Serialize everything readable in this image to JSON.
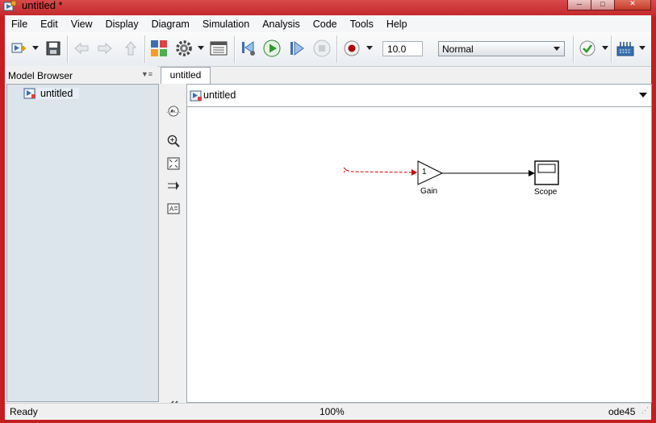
{
  "window": {
    "title": "untitled *"
  },
  "menubar": {
    "items": [
      "File",
      "Edit",
      "View",
      "Display",
      "Diagram",
      "Simulation",
      "Analysis",
      "Code",
      "Tools",
      "Help"
    ]
  },
  "toolbar": {
    "stop_time": "10.0",
    "sim_mode": "Normal",
    "icons": [
      "new-model-icon",
      "save-icon",
      "back-icon",
      "forward-icon",
      "up-icon",
      "library-browser-icon",
      "model-config-icon",
      "model-explorer-icon",
      "step-back-icon",
      "run-icon",
      "step-forward-icon",
      "stop-icon",
      "record-icon",
      "check-icon",
      "build-icon"
    ]
  },
  "model_browser": {
    "title": "Model Browser",
    "items": [
      {
        "label": "untitled"
      }
    ]
  },
  "tabs": [
    {
      "label": "untitled"
    }
  ],
  "address_bar": {
    "path": "untitled"
  },
  "diagram": {
    "blocks": [
      {
        "name": "Gain",
        "label": "Gain",
        "value": "1"
      },
      {
        "name": "Scope",
        "label": "Scope"
      }
    ]
  },
  "status": {
    "left": "Ready",
    "center": "100%",
    "right": "ode45"
  },
  "colors": {
    "accent": "#c41e22",
    "run": "#2f9b2f",
    "unconnected_line": "#cc0000"
  }
}
